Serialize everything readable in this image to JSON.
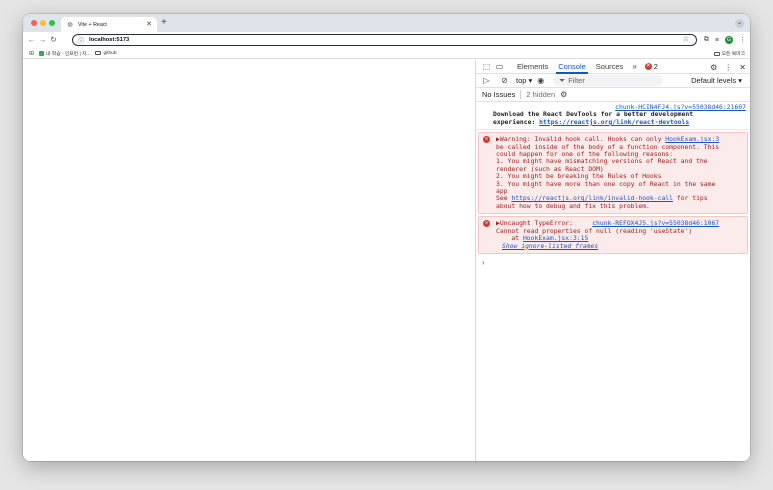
{
  "browser": {
    "tab_title": "Vite + React",
    "new_tab": "+",
    "url": "localhost:5173",
    "bookmarks": [
      {
        "label": "내 학습 - 인프런 | 지..."
      },
      {
        "label": "github"
      }
    ],
    "bookmarks_right": "모든 북마크",
    "profile_initial": "G"
  },
  "devtools": {
    "tabs": [
      {
        "label": "Elements",
        "active": false
      },
      {
        "label": "Console",
        "active": true
      },
      {
        "label": "Sources",
        "active": false
      }
    ],
    "more_tabs": "»",
    "error_count": "2",
    "context": "top",
    "filter_placeholder": "Filter",
    "levels": "Default levels",
    "issues": "No Issues",
    "hidden": "2 hidden",
    "messages": {
      "info": {
        "source": "chunk-HCIN4FJ4.js?v=55038d46:21607",
        "line1": "Download the React DevTools for a better development",
        "line2_prefix": "experience: ",
        "link": "https://reactjs.org/link/react-devtools"
      },
      "warning": {
        "prefix": "▶Warning: Invalid hook call. Hooks can only ",
        "source": "HookExam.jsx:3",
        "lines": [
          "be called inside of the body of a function component. This",
          "could happen for one of the following reasons:",
          "1. You might have mismatching versions of React and the",
          "renderer (such as React DOM)",
          "2. You might be breaking the Rules of Hooks",
          "3. You might have more than one copy of React in the same",
          "app"
        ],
        "see_prefix": "See ",
        "see_link": "https://reactjs.org/link/invalid-hook-call",
        "see_suffix": " for tips",
        "last_line": "about how to debug and fix this problem."
      },
      "error": {
        "prefix": "▶Uncaught TypeError:     ",
        "source": "chunk-REFOX4J5.js?v=55038d46:1067",
        "line1": "Cannot read properties of null (reading 'useState')",
        "at_prefix": "    at ",
        "at_link": "HookExam.jsx:3:15",
        "ignore": "Show ignore-listed frames"
      }
    },
    "prompt": "›"
  }
}
